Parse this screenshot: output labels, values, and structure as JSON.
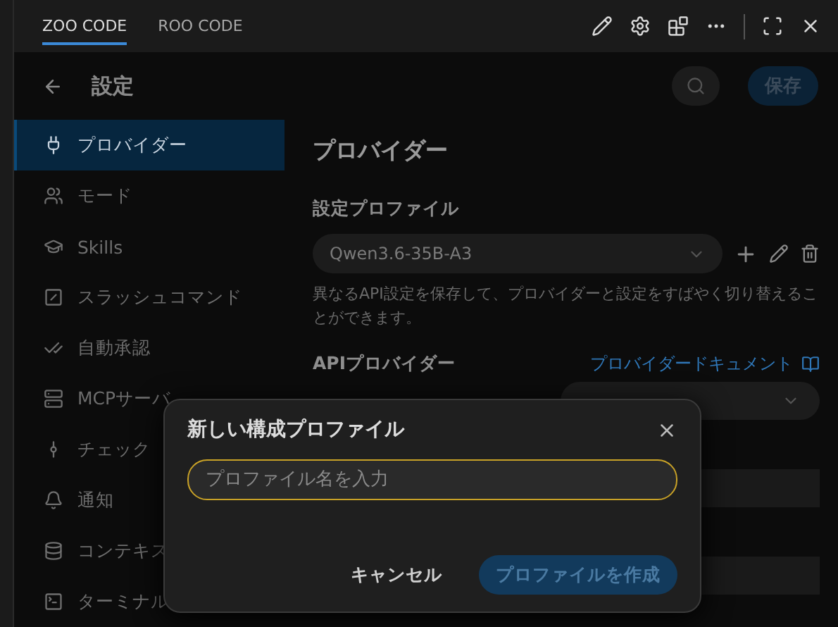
{
  "tabs": [
    {
      "label": "ZOO CODE",
      "selected": true
    },
    {
      "label": "ROO CODE",
      "selected": false
    }
  ],
  "header": {
    "title": "設定",
    "save_button": "保存"
  },
  "sidebar": {
    "items": [
      {
        "label": "プロバイダー",
        "kind": "plug",
        "selected": true
      },
      {
        "label": "モード",
        "kind": "users",
        "selected": false
      },
      {
        "label": "Skills",
        "kind": "cap",
        "selected": false
      },
      {
        "label": "スラッシュコマンド",
        "kind": "slash",
        "selected": false
      },
      {
        "label": "自動承認",
        "kind": "checks",
        "selected": false
      },
      {
        "label": "MCPサーバ",
        "kind": "server",
        "selected": false
      },
      {
        "label": "チェック",
        "kind": "commit",
        "selected": false
      },
      {
        "label": "通知",
        "kind": "bell",
        "selected": false
      },
      {
        "label": "コンテキス",
        "kind": "database",
        "selected": false
      },
      {
        "label": "ターミナル",
        "kind": "terminal",
        "selected": false
      }
    ]
  },
  "content": {
    "title": "プロバイダー",
    "profile_label": "設定プロファイル",
    "profile_value": "Qwen3.6-35B-A3",
    "profile_help": "異なるAPI設定を保存して、プロバイダーと設定をすばやく切り替えることができます。",
    "api_provider_label": "APIプロバイダー",
    "docs_link": "プロバイダードキュメント"
  },
  "dialog": {
    "title": "新しい構成プロファイル",
    "placeholder": "プロファイル名を入力",
    "cancel": "キャンセル",
    "create": "プロファイルを作成"
  }
}
